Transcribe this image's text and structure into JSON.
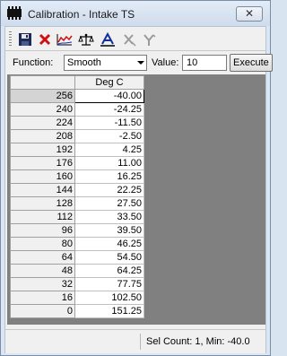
{
  "window": {
    "title": "Calibration - Intake TS",
    "close_label": "✕"
  },
  "toolbar": {
    "icons": [
      "save-icon",
      "delete-icon",
      "graph-icon",
      "balance-icon",
      "text-style-icon",
      "x-axis-icon",
      "y-axis-icon"
    ]
  },
  "function_bar": {
    "function_label": "Function:",
    "function_value": "Smooth",
    "value_label": "Value:",
    "value_value": "10",
    "execute_label": "Execute"
  },
  "grid": {
    "column_header": "Deg C",
    "rows": [
      {
        "label": "256",
        "value": "-40.00"
      },
      {
        "label": "240",
        "value": "-24.25"
      },
      {
        "label": "224",
        "value": "-11.50"
      },
      {
        "label": "208",
        "value": "-2.50"
      },
      {
        "label": "192",
        "value": "4.25"
      },
      {
        "label": "176",
        "value": "11.00"
      },
      {
        "label": "160",
        "value": "16.25"
      },
      {
        "label": "144",
        "value": "22.25"
      },
      {
        "label": "128",
        "value": "27.50"
      },
      {
        "label": "112",
        "value": "33.50"
      },
      {
        "label": "96",
        "value": "39.50"
      },
      {
        "label": "80",
        "value": "46.25"
      },
      {
        "label": "64",
        "value": "54.50"
      },
      {
        "label": "48",
        "value": "64.25"
      },
      {
        "label": "32",
        "value": "77.75"
      },
      {
        "label": "16",
        "value": "102.50"
      },
      {
        "label": "0",
        "value": "151.25"
      }
    ]
  },
  "status": {
    "text": "Sel Count: 1, Min: -40.0"
  }
}
